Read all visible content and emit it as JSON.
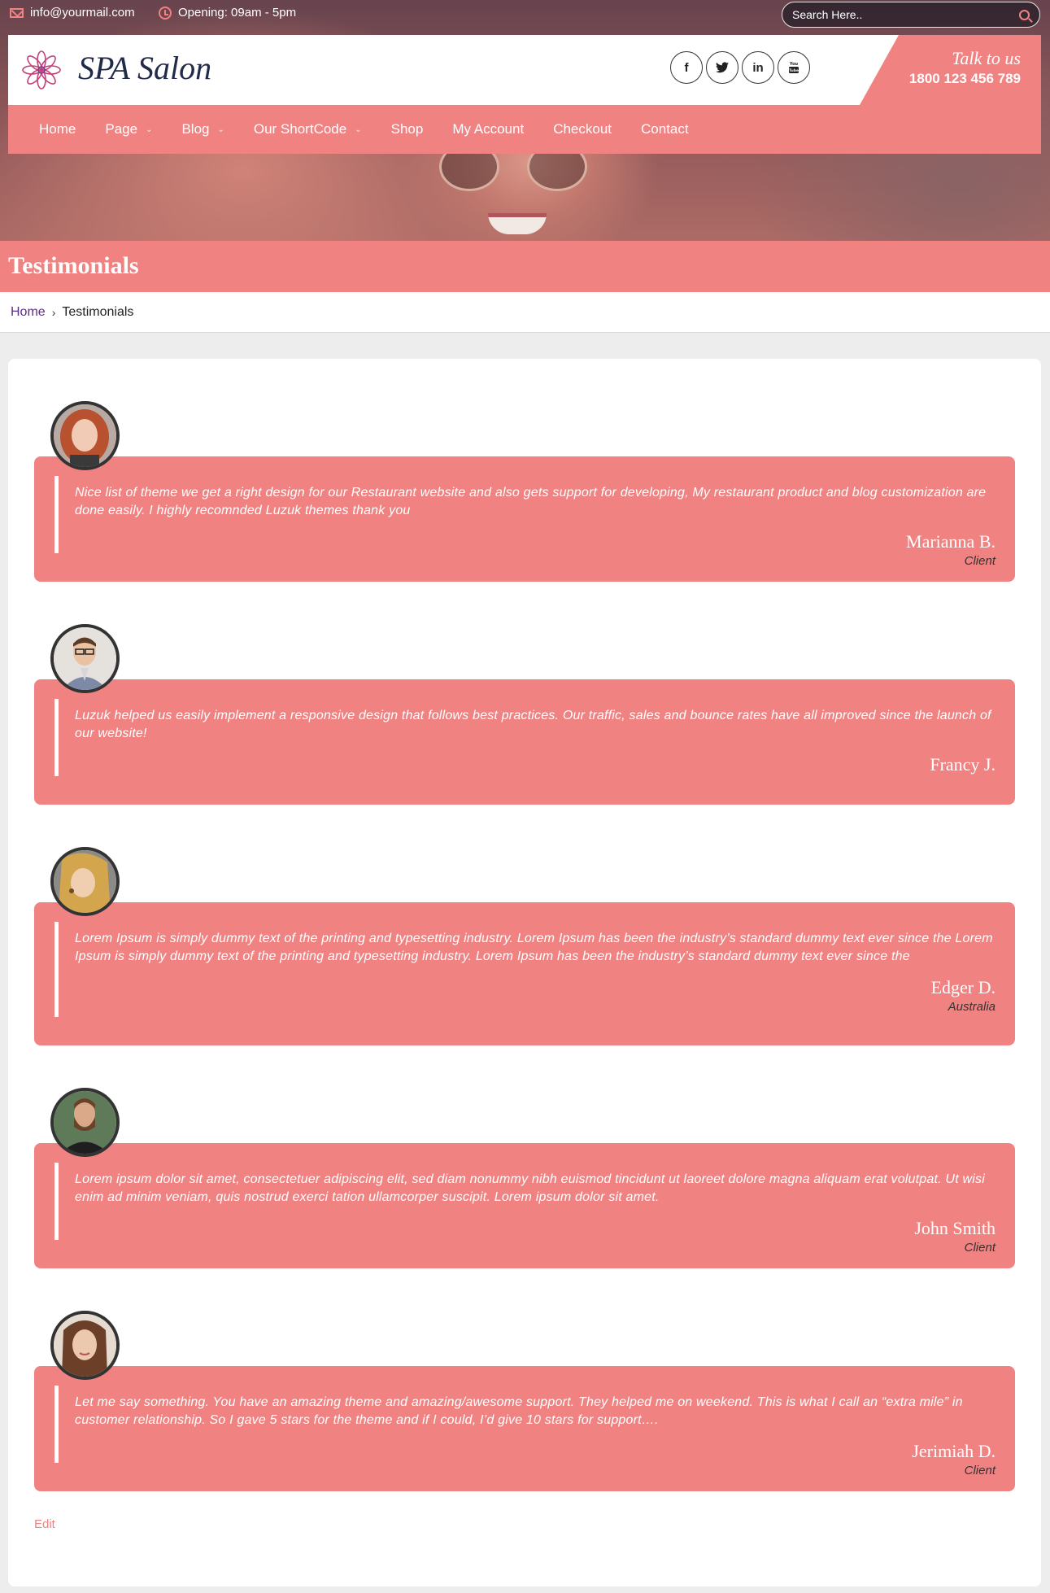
{
  "topbar": {
    "email": "info@yourmail.com",
    "opening": "Opening: 09am - 5pm",
    "search_placeholder": "Search Here.."
  },
  "brand": {
    "name": "SPA Salon",
    "talk_label": "Talk to us",
    "phone": "1800 123 456 789"
  },
  "socials": [
    {
      "icon": "facebook-icon",
      "glyph": "f"
    },
    {
      "icon": "twitter-icon",
      "glyph": "t"
    },
    {
      "icon": "linkedin-icon",
      "glyph": "in"
    },
    {
      "icon": "youtube-icon",
      "glyph": "You Tube"
    }
  ],
  "nav": {
    "items": [
      {
        "label": "Home",
        "has_dropdown": false
      },
      {
        "label": "Page",
        "has_dropdown": true
      },
      {
        "label": "Blog",
        "has_dropdown": true
      },
      {
        "label": "Our ShortCode",
        "has_dropdown": true
      },
      {
        "label": "Shop",
        "has_dropdown": false
      },
      {
        "label": "My Account",
        "has_dropdown": false
      },
      {
        "label": "Checkout",
        "has_dropdown": false
      },
      {
        "label": "Contact",
        "has_dropdown": false
      }
    ]
  },
  "page": {
    "title": "Testimonials",
    "breadcrumb": {
      "home": "Home",
      "current": "Testimonials"
    },
    "edit_label": "Edit"
  },
  "testimonials": [
    {
      "quote": "Nice list of theme we get a right design for our Restaurant website and also gets support for developing, My restaurant product and blog customization are done easily. I highly recomnded Luzuk themes thank you",
      "name": "Marianna B.",
      "role": "Client"
    },
    {
      "quote": "Luzuk helped us easily implement a responsive design that follows best practices. Our traffic, sales and bounce rates have all improved since the launch of our website!",
      "name": "Francy J.",
      "role": ""
    },
    {
      "quote": "Lorem Ipsum is simply dummy text of the printing and typesetting industry. Lorem Ipsum has been the industry’s standard dummy text ever since the Lorem Ipsum is simply dummy text of the printing and typesetting industry. Lorem Ipsum has been the industry’s standard dummy text ever since the",
      "name": "Edger D.",
      "role": "Australia"
    },
    {
      "quote": "Lorem ipsum dolor sit amet, consectetuer adipiscing elit, sed diam nonummy nibh euismod tincidunt ut laoreet dolore magna aliquam erat volutpat. Ut wisi enim ad minim veniam, quis nostrud exerci tation ullamcorper suscipit. Lorem ipsum dolor sit amet.",
      "name": "John Smith",
      "role": "Client"
    },
    {
      "quote": "Let me say something. You have an amazing theme and amazing/awesome support. They helped me on weekend. This is what I call an “extra mile” in customer relationship. So I gave 5 stars for the theme and if I could, I’d give 10 stars for support….",
      "name": "Jerimiah D.",
      "role": "Client"
    }
  ],
  "colors": {
    "accent": "#f08282",
    "brand_text": "#222a4a",
    "breadcrumb_link": "#5b2d86",
    "role_text": "#333333"
  }
}
